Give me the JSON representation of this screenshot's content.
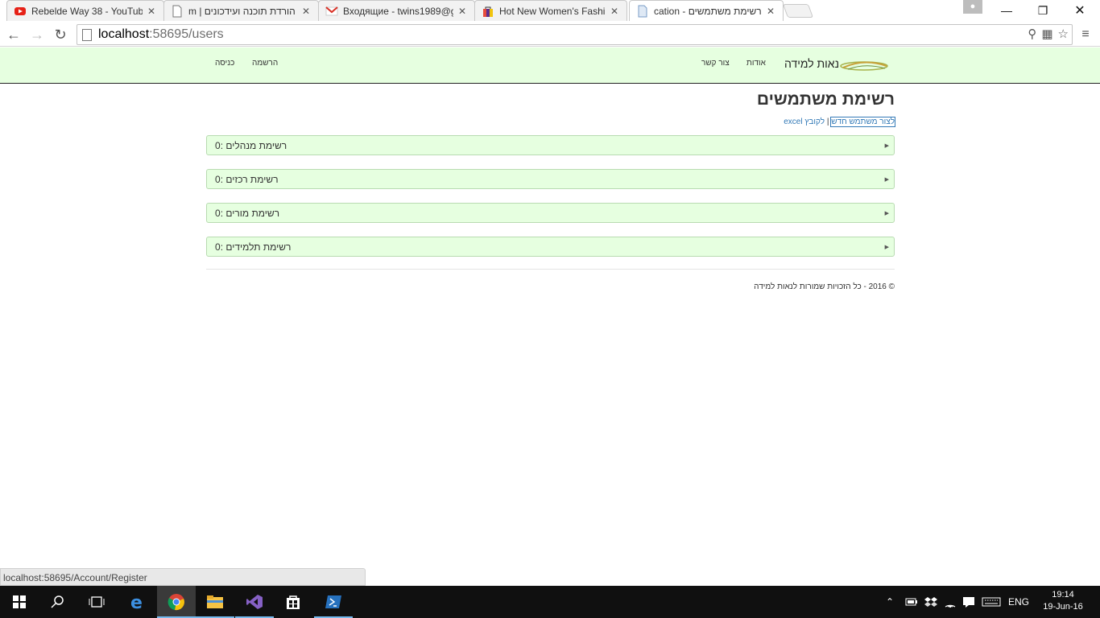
{
  "browser": {
    "tabs": [
      {
        "title": "Rebelde Way 38 - YouTub",
        "icon": "youtube-icon"
      },
      {
        "title": "הורדת תוכנה ועידכונים | m",
        "icon": "page-icon"
      },
      {
        "title": "Входящие - twins1989@g",
        "icon": "gmail-icon"
      },
      {
        "title": "Hot New Women's Fashio",
        "icon": "shop-bag-icon"
      },
      {
        "title": "רשימת משתמשים - cation",
        "icon": "page-icon"
      }
    ],
    "close_glyph": "✕",
    "url_host": "localhost",
    "url_rest": ":58695/users",
    "status_url": "localhost:58695/Account/Register"
  },
  "site": {
    "brand": "נאות למידה",
    "nav_about": "אודות",
    "nav_contact": "צור קשר",
    "nav_register": "הרשמה",
    "nav_login": "כניסה"
  },
  "page": {
    "title": "רשימת משתמשים",
    "link_new_user": "לצור משתמש חדש",
    "separator": "|",
    "link_excel": "לקובץ excel",
    "panels": [
      {
        "label": "רשימת מנהלים :0"
      },
      {
        "label": "רשימת רכזים :0"
      },
      {
        "label": "רשימת מורים :0"
      },
      {
        "label": "רשימת תלמידים :0"
      }
    ],
    "footer": "© 2016 - כל הזכויות שמורות לנאות למידה"
  },
  "taskbar": {
    "lang": "ENG",
    "time": "19:14",
    "date": "19-Jun-16"
  }
}
